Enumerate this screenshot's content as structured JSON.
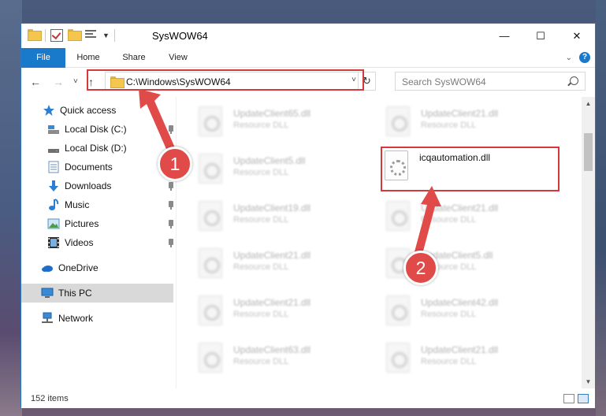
{
  "window": {
    "title": "SysWOW64",
    "controls": {
      "minimize": "—",
      "maximize": "☐",
      "close": "✕"
    }
  },
  "ribbon": {
    "tabs": [
      {
        "label": "File",
        "active": true
      },
      {
        "label": "Home"
      },
      {
        "label": "Share"
      },
      {
        "label": "View"
      }
    ],
    "help": "?"
  },
  "nav": {
    "back": "←",
    "forward": "→",
    "recent": "˅",
    "up": "↑",
    "address": "C:\\Windows\\SysWOW64",
    "address_dropdown": "˅",
    "refresh": "↻",
    "search_placeholder": "Search SysWOW64"
  },
  "sidebar": {
    "items": [
      {
        "label": "Quick access",
        "icon": "star-icon",
        "pinned": false
      },
      {
        "label": "Local Disk (C:)",
        "icon": "drive-c-icon",
        "pinned": true
      },
      {
        "label": "Local Disk (D:)",
        "icon": "drive-d-icon",
        "pinned": true
      },
      {
        "label": "Documents",
        "icon": "documents-icon",
        "pinned": true
      },
      {
        "label": "Downloads",
        "icon": "downloads-icon",
        "pinned": true
      },
      {
        "label": "Music",
        "icon": "music-icon",
        "pinned": true
      },
      {
        "label": "Pictures",
        "icon": "pictures-icon",
        "pinned": true
      },
      {
        "label": "Videos",
        "icon": "videos-icon",
        "pinned": true
      },
      {
        "label": "OneDrive",
        "icon": "onedrive-icon",
        "pinned": false
      },
      {
        "label": "This PC",
        "icon": "this-pc-icon",
        "pinned": false,
        "selected": true
      },
      {
        "label": "Network",
        "icon": "network-icon",
        "pinned": false
      }
    ]
  },
  "files": [
    {
      "name": "UpdateClient65.dll",
      "type": "Resource DLL"
    },
    {
      "name": "UpdateClient21.dll",
      "type": "Resource DLL"
    },
    {
      "name": "UpdateClient5.dll",
      "type": "Resource DLL"
    },
    {
      "name": "icqautomation.dll",
      "type": "",
      "highlighted": true
    },
    {
      "name": "UpdateClient19.dll",
      "type": "Resource DLL"
    },
    {
      "name": "UpdateClient21.dll",
      "type": "Resource DLL"
    },
    {
      "name": "UpdateClient21.dll",
      "type": "Resource DLL"
    },
    {
      "name": "UpdateClient5.dll",
      "type": "Resource DLL"
    },
    {
      "name": "UpdateClient21.dll",
      "type": "Resource DLL"
    },
    {
      "name": "UpdateClient42.dll",
      "type": "Resource DLL"
    },
    {
      "name": "UpdateClient63.dll",
      "type": "Resource DLL"
    },
    {
      "name": "UpdateClient21.dll",
      "type": "Resource DLL"
    }
  ],
  "status": {
    "item_count": "152 items"
  },
  "annotations": {
    "step1": "1",
    "step2": "2",
    "color": "#e04a49"
  }
}
